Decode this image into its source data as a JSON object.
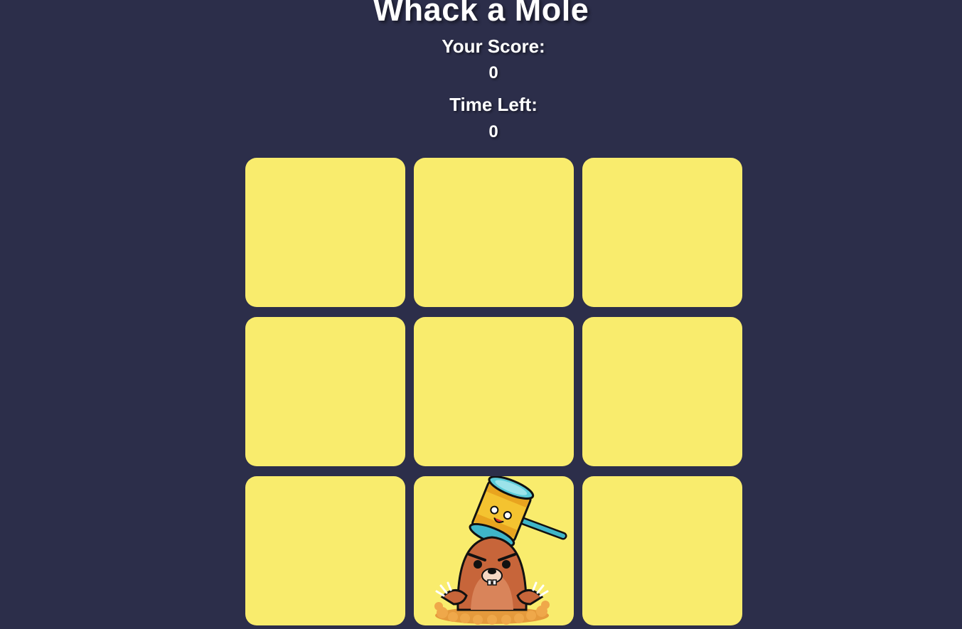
{
  "game": {
    "title": "Whack a Mole",
    "score_label": "Your Score:",
    "score_value": "0",
    "time_label": "Time Left:",
    "time_value": "0"
  },
  "board": {
    "rows": 3,
    "cols": 3,
    "mole_hole_index": 7,
    "hole_color": "#f9ec6d",
    "background_color": "#2c2e4a"
  },
  "icons": {
    "mole": "mole-icon",
    "hammer": "hammer-icon"
  }
}
